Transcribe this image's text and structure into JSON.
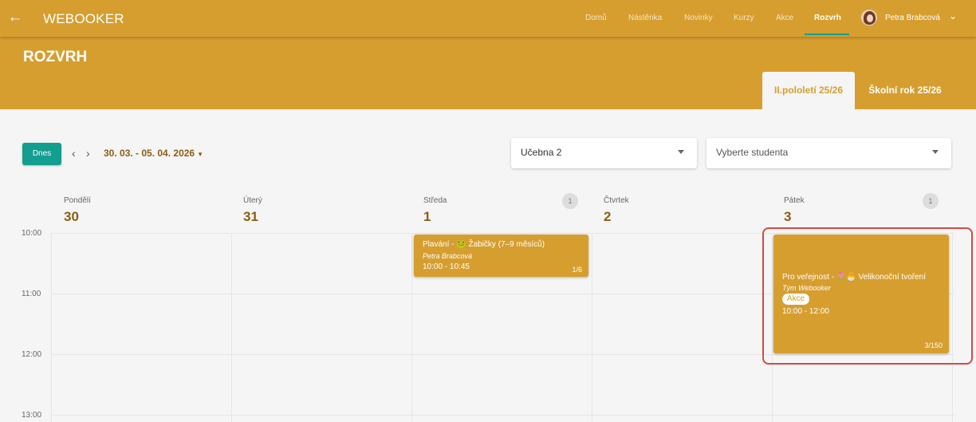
{
  "app": {
    "title": "WEBOOKER",
    "back_icon": "arrow-left-icon"
  },
  "nav": {
    "items": [
      "Domů",
      "Nástěnka",
      "Novinky",
      "Kurzy",
      "Akce",
      "Rozvrh"
    ],
    "active": "Rozvrh",
    "user_name": "Petra Brabcová"
  },
  "hero": {
    "title": "ROZVRH",
    "tabs": [
      "II.pololetí 25/26",
      "Školní rok 25/26"
    ],
    "active_tab": "II.pololetí 25/26"
  },
  "toolbar": {
    "today_label": "Dnes",
    "prev_label": "‹",
    "next_label": "›",
    "date_range": "30. 03. - 05. 04. 2026",
    "room_select": "Učebna 2",
    "student_select": "Vyberte studenta"
  },
  "days": [
    {
      "name": "Pondělí",
      "num": "30",
      "count": ""
    },
    {
      "name": "Úterý",
      "num": "31",
      "count": ""
    },
    {
      "name": "Středa",
      "num": "1",
      "count": "1"
    },
    {
      "name": "Čtvrtek",
      "num": "2",
      "count": ""
    },
    {
      "name": "Pátek",
      "num": "3",
      "count": "1"
    }
  ],
  "times": [
    "10:00",
    "11:00",
    "12:00",
    "13:00"
  ],
  "events": [
    {
      "title": "Plavání - 🐸 Žabičky (7–9 měsíců)",
      "teacher": "Petra Brabcová",
      "time": "10:00 - 10:45",
      "capacity": "1/6"
    },
    {
      "title": "Pro veřejnost - 🌷🐣 Velikonoční tvoření",
      "teacher": "Tým Webooker",
      "tag": "Akce",
      "time": "10:00 - 12:00",
      "capacity": "3/150"
    }
  ],
  "colors": {
    "primary": "#d69e2f",
    "accent": "#139e90",
    "highlight": "#d14b43"
  }
}
